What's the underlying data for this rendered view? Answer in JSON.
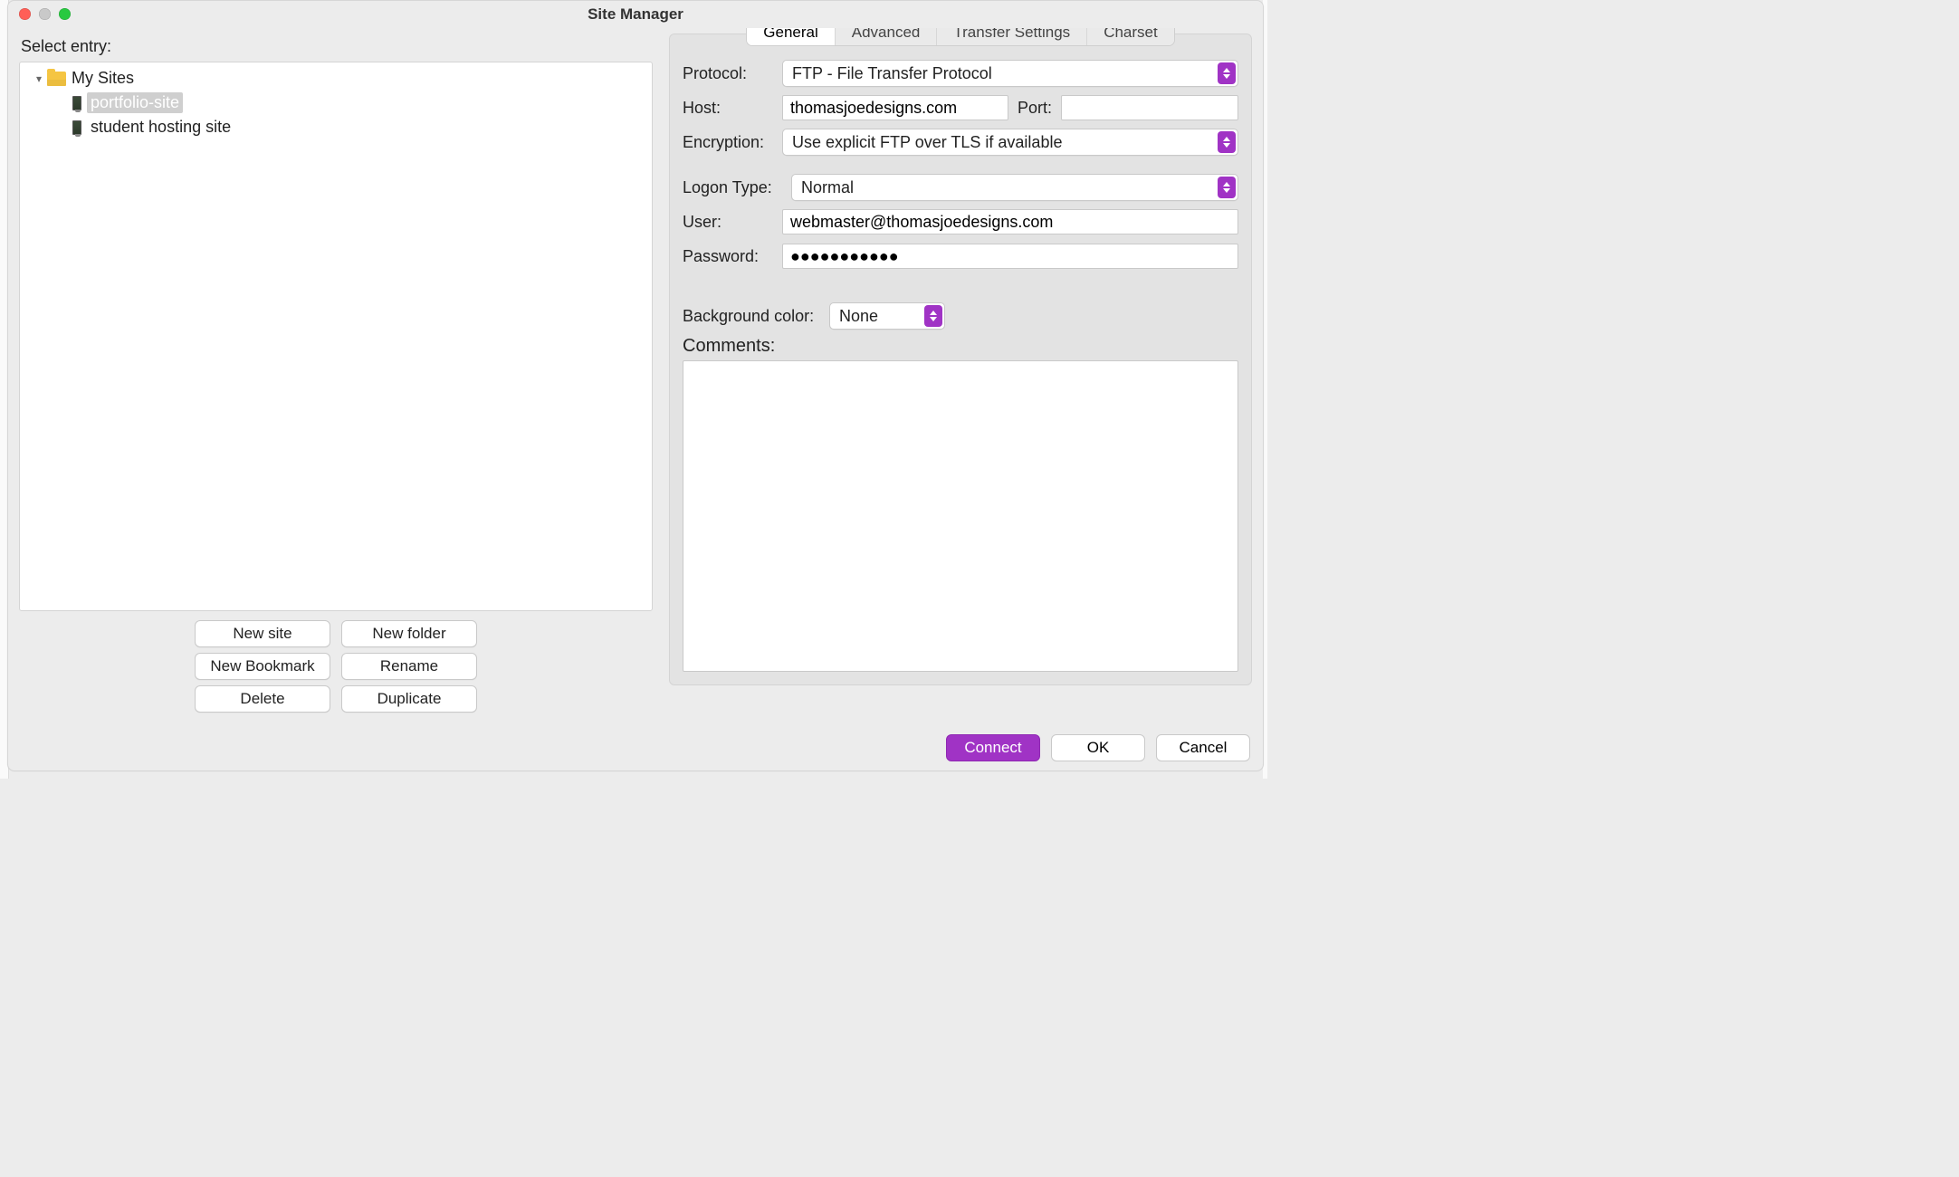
{
  "window": {
    "title": "Site Manager"
  },
  "left": {
    "select_label": "Select entry:",
    "root_label": "My Sites",
    "sites": [
      {
        "name": "portfolio-site",
        "selected": true
      },
      {
        "name": "student hosting site",
        "selected": false
      }
    ],
    "buttons": {
      "new_site": "New site",
      "new_folder": "New folder",
      "new_bookmark": "New Bookmark",
      "rename": "Rename",
      "delete": "Delete",
      "duplicate": "Duplicate"
    }
  },
  "tabs": {
    "general": "General",
    "advanced": "Advanced",
    "transfer": "Transfer Settings",
    "charset": "Charset",
    "active": "general"
  },
  "form": {
    "protocol_label": "Protocol:",
    "protocol_value": "FTP - File Transfer Protocol",
    "host_label": "Host:",
    "host_value": "thomasjoedesigns.com",
    "port_label": "Port:",
    "port_value": "",
    "encryption_label": "Encryption:",
    "encryption_value": "Use explicit FTP over TLS if available",
    "logon_label": "Logon Type:",
    "logon_value": "Normal",
    "user_label": "User:",
    "user_value": "webmaster@thomasjoedesigns.com",
    "password_label": "Password:",
    "password_value": "●●●●●●●●●●●",
    "bgcolor_label": "Background color:",
    "bgcolor_value": "None",
    "comments_label": "Comments:",
    "comments_value": ""
  },
  "footer": {
    "connect": "Connect",
    "ok": "OK",
    "cancel": "Cancel"
  }
}
